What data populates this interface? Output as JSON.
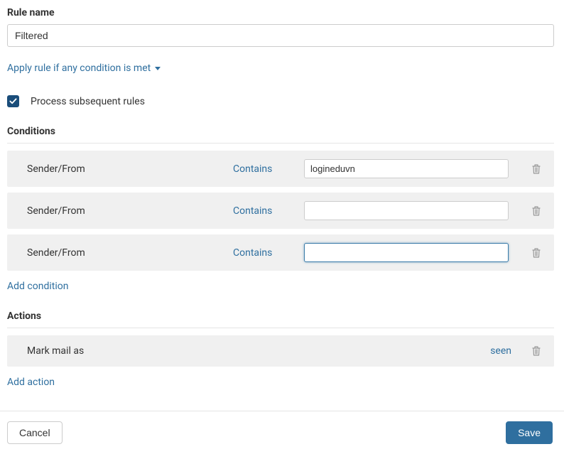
{
  "rule_name": {
    "label": "Rule name",
    "value": "Filtered"
  },
  "apply_rule": {
    "label": "Apply rule if any condition is met"
  },
  "process_subsequent": {
    "label": "Process subsequent rules",
    "checked": true
  },
  "conditions": {
    "title": "Conditions",
    "rows": [
      {
        "field": "Sender/From",
        "operator": "Contains",
        "value": "logineduvn",
        "focused": false
      },
      {
        "field": "Sender/From",
        "operator": "Contains",
        "value": "",
        "focused": false
      },
      {
        "field": "Sender/From",
        "operator": "Contains",
        "value": "",
        "focused": true
      }
    ],
    "add_label": "Add condition"
  },
  "actions": {
    "title": "Actions",
    "rows": [
      {
        "field": "Mark mail as",
        "value": "seen"
      }
    ],
    "add_label": "Add action"
  },
  "footer": {
    "cancel": "Cancel",
    "save": "Save"
  }
}
